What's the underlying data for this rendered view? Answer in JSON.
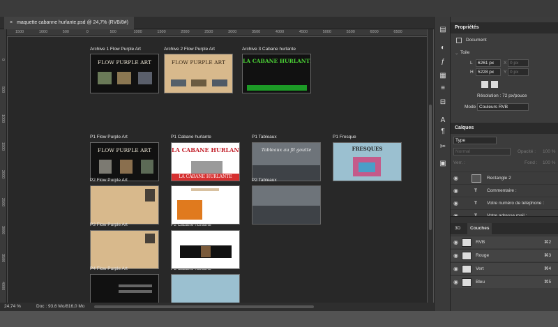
{
  "document": {
    "tab_title": "maquette cabanne hurlante.psd @ 24,7% (RVB/8#)",
    "close_glyph": "×",
    "zoom_status": "24,74 %",
    "doc_status": "Doc : 93,6 Mo/816,0 Mo"
  },
  "ruler": {
    "h_ticks": [
      "1500",
      "1000",
      "500",
      "0",
      "500",
      "1000",
      "1500",
      "2000",
      "2500",
      "3000",
      "3500",
      "4000",
      "4500",
      "5000",
      "5500",
      "6000",
      "6500"
    ],
    "v_ticks": [
      "0",
      "500",
      "1000",
      "1500",
      "2000",
      "2500",
      "3000",
      "3500",
      "4000"
    ]
  },
  "artboards": [
    {
      "label": "Archive 1 Flow Purple Art",
      "title": "FLOW PURPLE ART"
    },
    {
      "label": "Archive 2 Flow Purple Art",
      "title": "FLOW PURPLE ART"
    },
    {
      "label": "Archive 3 Cabane hurlante",
      "title": "LA CABANE HURLANTE"
    },
    {
      "label": "P1 Flow Purple Art",
      "title": "FLOW PURPLE ART"
    },
    {
      "label": "P1 Cabane hurlante",
      "title": "LA CABANE HURLANTE",
      "banner": "LA CABANE HURLANTE"
    },
    {
      "label": "P1 Tableaux",
      "title": "Tableaux au fil goutte"
    },
    {
      "label": "P1 Fresque",
      "title": "FRESQUES"
    },
    {
      "label": "P2 Flow Purple Art"
    },
    {
      "label": "P2 Cabane hurlante"
    },
    {
      "label": "P2 Tableaux"
    },
    {
      "label": "P3 Flow Purple Art"
    },
    {
      "label": "P3 Cabane hurlante"
    },
    {
      "label": "P4 Flow Purple Art"
    },
    {
      "label": "P4 Cabane hurlante"
    }
  ],
  "properties": {
    "panel_title": "Propriétés",
    "doc_label": "Document",
    "section_toile": "Toile",
    "width_label": "L",
    "width_value": "6261 px",
    "height_label": "H",
    "height_value": "5228 px",
    "x_label": "X",
    "x_value": "0 px",
    "y_label": "Y",
    "y_value": "0 px",
    "resolution": "Résolution : 72 px/pouce",
    "mode_label": "Mode",
    "mode_value": "Couleurs RVB"
  },
  "layers": {
    "panel_title": "Calques",
    "filter_value": "Type",
    "blend_mode": "Normal",
    "opacity_label": "Opacité :",
    "opacity_value": "100 %",
    "lock_label": "Verr. :",
    "fill_label": "Fond :",
    "fill_value": "100 %",
    "items": [
      {
        "name": "Rectangle 2",
        "kind": "shape"
      },
      {
        "name": "Commentaire :",
        "kind": "text"
      },
      {
        "name": "Votre numéro de telephone :",
        "kind": "text"
      },
      {
        "name": "Votre adresse mail :",
        "kind": "text"
      }
    ]
  },
  "channels": {
    "tab_3d": "3D",
    "tab_couches": "Couches",
    "items": [
      {
        "name": "RVB",
        "shortcut": "⌘2"
      },
      {
        "name": "Rouge",
        "shortcut": "⌘3"
      },
      {
        "name": "Vert",
        "shortcut": "⌘4"
      },
      {
        "name": "Bleu",
        "shortcut": "⌘5"
      }
    ]
  }
}
